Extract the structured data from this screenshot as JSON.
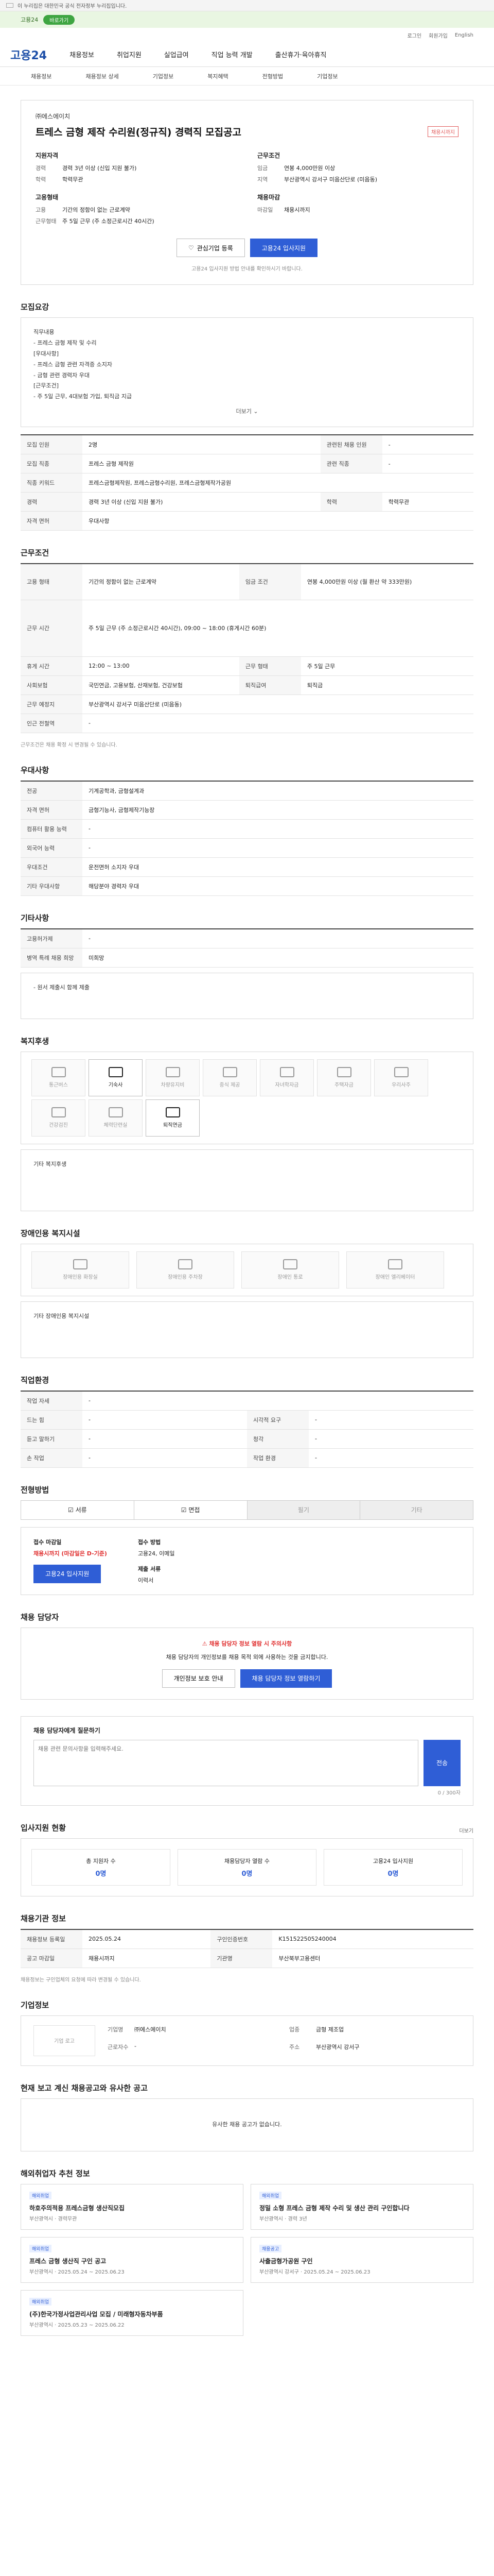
{
  "top": {
    "gov_notice": "이 누리집은 대한민국 공식 전자정부 누리집입니다.",
    "banner_text": "고용24",
    "banner_pill": "바로가기",
    "util": [
      "로그인",
      "회원가입",
      "English"
    ]
  },
  "gnb": {
    "logo": "고용24",
    "items": [
      "채용정보",
      "취업지원",
      "실업급여",
      "직업 능력 개발",
      "출산휴가·육아휴직"
    ]
  },
  "lnb": [
    "채용정보",
    "채용정보 상세",
    "기업정보",
    "복지혜택",
    "전형방법",
    "기업정보"
  ],
  "job": {
    "company": "㈜에스에이치",
    "title": "트레스 금형 제작 수리원(정규직) 경력직 모집공고",
    "dday": "채용시까지",
    "left_heading": "지원자격",
    "left": [
      {
        "k": "경력",
        "v": "경력 3년 이상 (신입 지원 불가)"
      },
      {
        "k": "학력",
        "v": "학력무관"
      }
    ],
    "left2_heading": "고용형태",
    "left2": [
      {
        "k": "고용",
        "v": "기간의 정함이 없는 근로계약"
      },
      {
        "k": "근무형태",
        "v": "주 5일 근무 (주 소정근로시간 40시간)"
      }
    ],
    "right_heading": "근무조건",
    "right": [
      {
        "k": "임금",
        "v": "연봉 4,000만원 이상"
      },
      {
        "k": "지역",
        "v": "부산광역시 강서구 미음산단로 (미음동)"
      }
    ],
    "right2_heading": "채용마감",
    "right2": [
      {
        "k": "마감일",
        "v": "채용시까지"
      }
    ],
    "scrap_label": "관심기업 등록",
    "apply_label": "고용24 입사지원",
    "notice": "고용24 입사지원 방법 안내를 확인하시기 바랍니다."
  },
  "recruit": {
    "title": "모집요강",
    "body": [
      "직무내용",
      "- 프레스 금형 제작 및 수리",
      "[우대사항]",
      "- 프레스 금형 관련 자격증 소지자",
      "- 금형 관련 경력자 우대",
      "[근무조건]",
      "- 주 5일 근무, 4대보험 가입, 퇴직금 지급"
    ],
    "more": "더보기",
    "rows": [
      {
        "k": "모집 인원",
        "v": "2명",
        "k2": "관련된 채용 인원",
        "v2": "-"
      },
      {
        "k": "모집 직종",
        "v": "프레스 금형 제작원",
        "k2": "관련 직종",
        "v2": "-"
      },
      {
        "k": "직종 키워드",
        "v": "프레스금형제작원, 프레스금형수리원, 프레스금형제작가공원",
        "k2": "",
        "v2": ""
      },
      {
        "k": "경력",
        "v": "경력 3년 이상 (신입 지원 불가)",
        "k2": "학력",
        "v2": "학력무관"
      },
      {
        "k": "자격 면허",
        "v": "우대사항",
        "k2": "",
        "v2": ""
      }
    ]
  },
  "conditions": {
    "title": "근무조건",
    "rows": [
      {
        "k": "고용 형태",
        "v": "기간의 정함이 없는 근로계약",
        "k2": "임금 조건",
        "v2": "연봉 4,000만원 이상 (월 환산 약 333만원)"
      },
      {
        "k": "근무 시간",
        "v": "주 5일 근무 (주 소정근로시간 40시간), 09:00 ~ 18:00 (휴게시간 60분)",
        "k2": "",
        "v2": ""
      },
      {
        "k": "휴게 시간",
        "v": "12:00 ~ 13:00",
        "k2": "근무 형태",
        "v2": "주 5일 근무"
      },
      {
        "k": "사회보험",
        "v": "국민연금, 고용보험, 산재보험, 건강보험",
        "k2": "퇴직급여",
        "v2": "퇴직금"
      },
      {
        "k": "근무 예정지",
        "v": "부산광역시 강서구 미음산단로 (미음동)",
        "k2": "",
        "v2": ""
      },
      {
        "k": "인근 전철역",
        "v": "-",
        "k2": "",
        "v2": ""
      }
    ],
    "footnote": "근무조건은 채용 확정 시 변경될 수 있습니다."
  },
  "preference": {
    "title": "우대사항",
    "rows": [
      {
        "k": "전공",
        "v": "기계공학과, 금형설계과"
      },
      {
        "k": "자격 면허",
        "v": "금형기능사, 금형제작기능장"
      },
      {
        "k": "컴퓨터 활용 능력",
        "v": "-"
      },
      {
        "k": "외국어 능력",
        "v": "-"
      },
      {
        "k": "우대조건",
        "v": "운전면허 소지자 우대"
      },
      {
        "k": "기타 우대사항",
        "v": "해당분야 경력자 우대"
      }
    ]
  },
  "other": {
    "title": "기타사항",
    "rows": [
      {
        "k": "고용허가제",
        "v": "-"
      },
      {
        "k": "병역 특례 채용 희망",
        "v": "미희망"
      }
    ],
    "note": "- 원서 제출시 함께 제출"
  },
  "welfare": {
    "title": "복지후생",
    "items": [
      {
        "label": "통근버스",
        "on": false
      },
      {
        "label": "기숙사",
        "on": true
      },
      {
        "label": "차량유지비",
        "on": false
      },
      {
        "label": "중식 제공",
        "on": false
      },
      {
        "label": "자녀학자금",
        "on": false
      },
      {
        "label": "주택자금",
        "on": false
      },
      {
        "label": "우리사주",
        "on": false
      },
      {
        "label": "건강검진",
        "on": false
      },
      {
        "label": "체력단련실",
        "on": false
      },
      {
        "label": "퇴직연금",
        "on": true
      }
    ],
    "note": "기타 복지후생"
  },
  "disability": {
    "title": "장애인용 복지시설",
    "items": [
      "장애인용 화장실",
      "장애인용 주차장",
      "장애인 통로",
      "장애인 엘리베이터"
    ],
    "note": "기타 장애인용 복지시설"
  },
  "career": {
    "title": "직업환경",
    "rows": [
      {
        "k": "작업 자세",
        "v": "-",
        "k2": "",
        "v2": ""
      },
      {
        "k": "드는 힘",
        "v": "-",
        "k2": "시각적 요구",
        "v2": "-"
      },
      {
        "k": "듣고 말하기",
        "v": "-",
        "k2": "청각",
        "v2": "-"
      },
      {
        "k": "손 작업",
        "v": "-",
        "k2": "작업 환경",
        "v2": "-"
      }
    ]
  },
  "process": {
    "title": "전형방법",
    "tabs": [
      "서류",
      "면접",
      "필기",
      "기타"
    ],
    "left_heading": "접수 마감일",
    "deadline": "채용시까지 (마감일은 D-기준)",
    "apply_btn": "고용24 입사지원",
    "method_heading": "접수 방법",
    "method": "고용24, 이메일",
    "docs_heading": "제출 서류",
    "docs": "이력서"
  },
  "warning": {
    "title": "채용 담당자",
    "highlight": "채용 담당자 정보 열람 시 주의사항",
    "body": "채용 담당자의 개인정보를 채용 목적 외에 사용하는 것을 금지합니다.",
    "btn1": "개인정보 보호 안내",
    "btn2": "채용 담당자 정보 열람하기"
  },
  "qa": {
    "title": "채용 담당자에게 질문하기",
    "placeholder": "채용 관련 문의사항을 입력해주세요.",
    "submit": "전송",
    "counter": "0 / 300자"
  },
  "stats": {
    "title": "입사지원 현황",
    "link": "더보기",
    "items": [
      {
        "label": "총 지원자 수",
        "value": "0명"
      },
      {
        "label": "채용담당자 열람 수",
        "value": "0명"
      },
      {
        "label": "고용24 입사지원",
        "value": "0명"
      }
    ]
  },
  "meta": {
    "title": "채용기관 정보",
    "rows": [
      {
        "k": "채용정보 등록일",
        "v": "2025.05.24",
        "k2": "구인인증번호",
        "v2": "K151522505240004"
      },
      {
        "k": "공고 마감일",
        "v": "채용시까지",
        "k2": "기관명",
        "v2": "부산북부고용센터"
      }
    ],
    "note": "채용정보는 구인업체의 요청에 따라 변경될 수 있습니다."
  },
  "company": {
    "title": "기업정보",
    "logo": "기업 로고",
    "rows": [
      {
        "k": "기업명",
        "v": "㈜에스에이치"
      },
      {
        "k": "업종",
        "v": "금형 제조업"
      },
      {
        "k": "근로자수",
        "v": "-"
      },
      {
        "k": "주소",
        "v": "부산광역시 강서구"
      }
    ]
  },
  "similar": {
    "title": "현재 보고 계신 채용공고와 유사한 공고",
    "empty": "유사한 채용 공고가 없습니다."
  },
  "recommend": {
    "title": "해외취업자 추천 정보",
    "items": [
      {
        "badge": "해외취업",
        "name": "하호주의적용 프레스금형 생산직모집",
        "meta": "부산광역시 · 경력무관"
      },
      {
        "badge": "해외취업",
        "name": "정밀 소형 프레스 금형 제작 수리 및 생산 관리 구인합니다",
        "meta": "부산광역시 · 경력 3년"
      },
      {
        "badge": "해외취업",
        "name": "프레스 금형 생산직 구인 공고",
        "meta": "부산광역시 · 2025.05.24 ~ 2025.06.23"
      },
      {
        "badge": "채용공고",
        "name": "사출금형가공원 구인",
        "meta": "부산광역시 강서구 · 2025.05.24 ~ 2025.06.23"
      },
      {
        "badge": "해외취업",
        "name": "(주)한국가정사업관리사업 모집 / 미래형자동차부품",
        "meta": "부산광역시 · 2025.05.23 ~ 2025.06.22"
      }
    ]
  }
}
